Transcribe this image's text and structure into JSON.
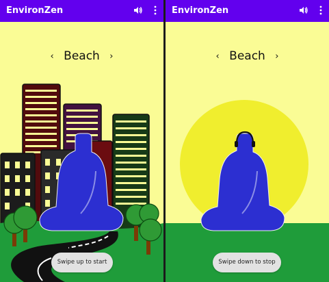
{
  "app": {
    "title": "EnvironZen"
  },
  "icons": {
    "volume": "volume-icon",
    "overflow": "more-vert-icon",
    "prev": "chevron-left-icon",
    "next": "chevron-right-icon"
  },
  "colors": {
    "app_bar": "#6200ee",
    "background": "#fafc95",
    "figure": "#2c2fd1",
    "sun": "#f0ee2e",
    "ground": "#1f9c3a"
  },
  "screens": [
    {
      "scene": "Beach",
      "prev_symbol": "‹",
      "next_symbol": "›",
      "hint": "Swipe up to start"
    },
    {
      "scene": "Beach",
      "prev_symbol": "‹",
      "next_symbol": "›",
      "hint": "Swipe down to stop"
    }
  ]
}
